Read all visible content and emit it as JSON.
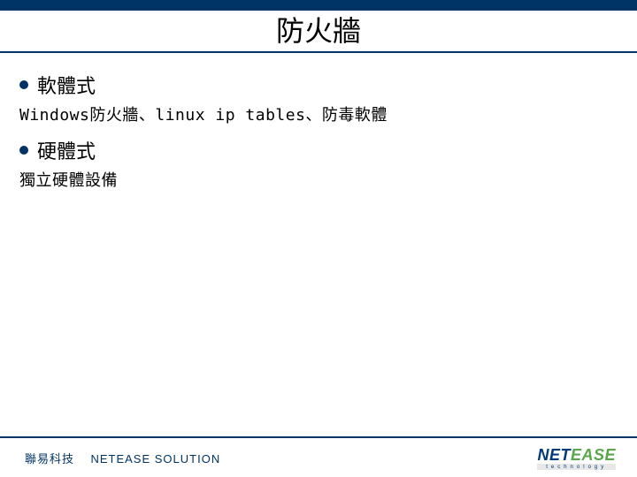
{
  "title": "防火牆",
  "sections": [
    {
      "heading": "軟體式",
      "body": "Windows防火牆、linux ip tables、防毒軟體"
    },
    {
      "heading": "硬體式",
      "body": "獨立硬體設備"
    }
  ],
  "footer": {
    "company_cn": "聯易科技",
    "company_en": "NETEASE SOLUTION",
    "logo_part1": "NET",
    "logo_part2": "EASE",
    "logo_sub": "technology"
  }
}
